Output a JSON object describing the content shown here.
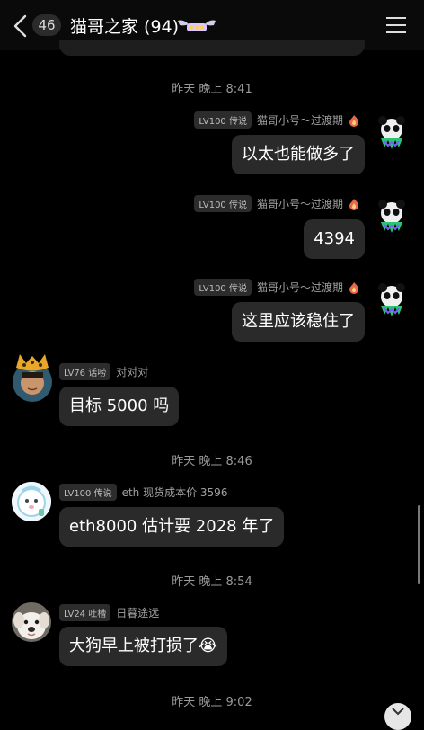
{
  "header": {
    "unread_count": "46",
    "title": "猫哥之家 (94)"
  },
  "messages": [
    {
      "type": "time",
      "text": "昨天 晚上 8:41"
    },
    {
      "type": "msg",
      "side": "right",
      "level": "LV100 传说",
      "name": "猫哥小号～过渡期",
      "text": "以太也能做多了"
    },
    {
      "type": "msg",
      "side": "right",
      "level": "LV100 传说",
      "name": "猫哥小号～过渡期",
      "text": "4394"
    },
    {
      "type": "msg",
      "side": "right",
      "level": "LV100 传说",
      "name": "猫哥小号～过渡期",
      "text": "这里应该稳住了"
    },
    {
      "type": "msg",
      "side": "left",
      "level": "LV76 话唠",
      "name": "对对对",
      "text": "目标 5000 吗"
    },
    {
      "type": "time",
      "text": "昨天 晚上 8:46"
    },
    {
      "type": "msg",
      "side": "left",
      "level": "LV100 传说",
      "name": "eth 现货成本价 3596",
      "text": "eth8000 估计要 2028 年了"
    },
    {
      "type": "time",
      "text": "昨天 晚上 8:54"
    },
    {
      "type": "msg",
      "side": "left",
      "level": "LV24 吐槽",
      "name": "日暮途远",
      "text": "大狗早上被打损了",
      "emoji": "😭"
    },
    {
      "type": "time",
      "text": "昨天 晚上 9:02"
    }
  ]
}
